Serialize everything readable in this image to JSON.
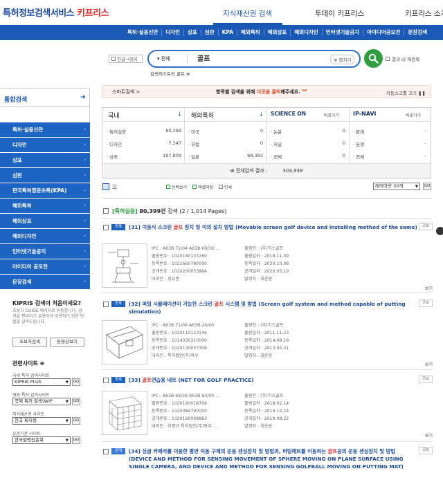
{
  "header": {
    "logo_main": "특허정보검색서비스 ",
    "logo_brand": "키프리스",
    "gnb": [
      "지식재산권 검색",
      "투데이 키프리스",
      "키프리스 소개"
    ]
  },
  "menu": [
    "특허·실용신안",
    "디자인",
    "상표",
    "심판",
    "KPA",
    "해외특허",
    "해외상표",
    "해외디자인",
    "인터넷기술공지",
    "아이디어공모전",
    "문장검색"
  ],
  "search": {
    "lang_label": "한글→영어",
    "scope": "▾ 전체",
    "query": "골프",
    "fold_label": "펼치기",
    "within_label": "결과 내 재검색",
    "history": "검색히스토리  골프 ⊗"
  },
  "sidebar": {
    "title": "통합검색",
    "items": [
      "특허·실용신안",
      "디자인",
      "상표",
      "심판",
      "한국특허영문초록(KPA)",
      "해외특허",
      "해외상표",
      "해외디자인",
      "인터넷기술공지",
      "아이디어 공모전",
      "문장검색"
    ],
    "kipris_q": "KIPRIS 검색이 처음이세요?",
    "kipris_desc": "초보자 GUIDE 페이지로 이동합니다. 검색을 편리하고 유용하게 이용하기 위한 방법을 알려드립니다.",
    "btn_guide": "초보자검색",
    "btn_video": "동영상보기",
    "related_title": "관련사이트 ⊕",
    "related": [
      {
        "label": "국내 특허 검색사이트",
        "value": "KIPRIS PLUS"
      },
      {
        "label": "해외 특허 검색사이트",
        "value": "국제 특허 검색(WIP"
      },
      {
        "label": "지식재산권 사이트",
        "value": "한국 특허청"
      },
      {
        "label": "유관기관 사이트",
        "value": "한국발명진흥회"
      }
    ],
    "go": "GO"
  },
  "smartbar": {
    "left": "스마트검색 >",
    "center_pre": "항목별 검색을 위해 ",
    "center_hl": "이곳을 클릭",
    "center_post": "해주세요.",
    "right": "자동스크롤 끄기 ❚❚"
  },
  "stats": {
    "domestic": {
      "title": "국내",
      "rows": [
        [
          "특허실용",
          "80,399"
        ],
        [
          "디자인",
          "7,347"
        ],
        [
          "상표",
          "197,809"
        ]
      ]
    },
    "foreign": {
      "title": "해외특허",
      "rows": [
        [
          "미국",
          "0"
        ],
        [
          "유럽",
          "0"
        ],
        [
          "일본",
          "68,383"
        ]
      ]
    },
    "science": {
      "title": "SCIENCE ON",
      "shortcut": "바로가기",
      "rows": [
        [
          "논문",
          "0"
        ],
        [
          "저널",
          "0"
        ],
        [
          "전체",
          "0"
        ]
      ]
    },
    "ipnavi": {
      "title": "IP-NAVI",
      "shortcut": "바로가기",
      "rows": [
        [
          "판례",
          "-"
        ],
        [
          "분쟁",
          "-"
        ],
        [
          "전체",
          "-"
        ]
      ]
    },
    "total_label": "⊞ 전체검색 결과 :",
    "total_value": "303,938"
  },
  "tools": {
    "opt1": "선택보기",
    "opt2": "엑셀저장",
    "opt3": "인쇄",
    "sort": "레이아웃 30개",
    "sort_go": "GO"
  },
  "result_header": {
    "category": "[특허실용]",
    "count": "80,399건",
    "rest": " 검색 (2 / 1,014 Pages)"
  },
  "results": [
    {
      "status": "등록",
      "num": "[31]",
      "title_pre": " 이동식 스크린 ",
      "hl": "골프",
      "title_post": " 장치 및 이의 설치 방법 (Movable screen golf device and installing method of the same)",
      "ipc": "IPC : A63B 71/04 A63B 69/36 ...",
      "applicant": "출원인 : (주)익스골프",
      "app_no": "출원번호 : 1020180137260",
      "app_date": "출원일자 : 2018.11.09",
      "reg_no": "등록번호 : 1021660780000",
      "reg_date": "등록일자 : 2020.10.08",
      "pub_no": "공개번호 : 1020200053884",
      "pub_date": "공개일자 : 2020.05.19",
      "agent": "대리인 : 정유준",
      "inventor": "발명자 : 최윤원",
      "more": "보기",
      "pub": "공보"
    },
    {
      "status": "등록",
      "num": "[32]",
      "title_pre": " 퍼팅 시뮬레이션이 가능한 스크린 ",
      "hl": "골프",
      "title_post": " 시스템 및 방법 (Screen golf system and method capable of putting simulation)",
      "ipc": "IPC : A63B 71/06 A63B 24/00",
      "applicant": "출원인 : (주)익스골프",
      "app_no": "출원번호 : 1020110123146",
      "app_date": "출원일자 : 2011.11.23",
      "reg_no": "등록번호 : 1014330310000",
      "reg_date": "등록일자 : 2014.08.18",
      "pub_no": "공개번호 : 1020130057308",
      "pub_date": "공개일자 : 2013.05.31",
      "agent": "대리인 : 특허법인(주)와우",
      "inventor": "발명자 : 최윤원",
      "more": "보기",
      "pub": "공보"
    },
    {
      "status": "등록",
      "num": "[33]",
      "title_pre": " ",
      "hl": "골프",
      "title_post": "연습용 네트 (NET FOR GOLF PRACTICE)",
      "ipc": "IPC : A63B 69/36 A63B 63/00 ...",
      "applicant": "출원인 : (주)익스골프",
      "app_no": "출원번호 : 1020180018708",
      "app_date": "출원일자 : 2018.02.14",
      "reg_no": "등록번호 : 1020384790000",
      "reg_date": "등록일자 : 2019.10.24",
      "pub_no": "공개번호 : 1020190098883",
      "pub_date": "공개일자 : 2019.08.22",
      "agent": "대리인 : 이영규 특허법인(주)와우 ...",
      "inventor": "발명자 : 최윤원",
      "more": "보기",
      "pub": "공보"
    },
    {
      "status": "공개",
      "num": "[34]",
      "title_pre": " 싱글 카메라를 이용한 평면 이동 구체의 운동 센싱장치 및 방법과, 퍼팅매트를 이동하는 ",
      "hl": "골프",
      "title_post": "공의 운동 센싱장치 및 방법 (DEVICE AND METHOD FOR SENSING MOVEMENT OF SPHERE MOVING ON PLANE SURFACE USING SINGLE CAMERA, AND DEVICE AND METHOD FOR SENSING GOLFBALL MOVING ON PUTTING MAT)",
      "pub": "공보"
    }
  ]
}
